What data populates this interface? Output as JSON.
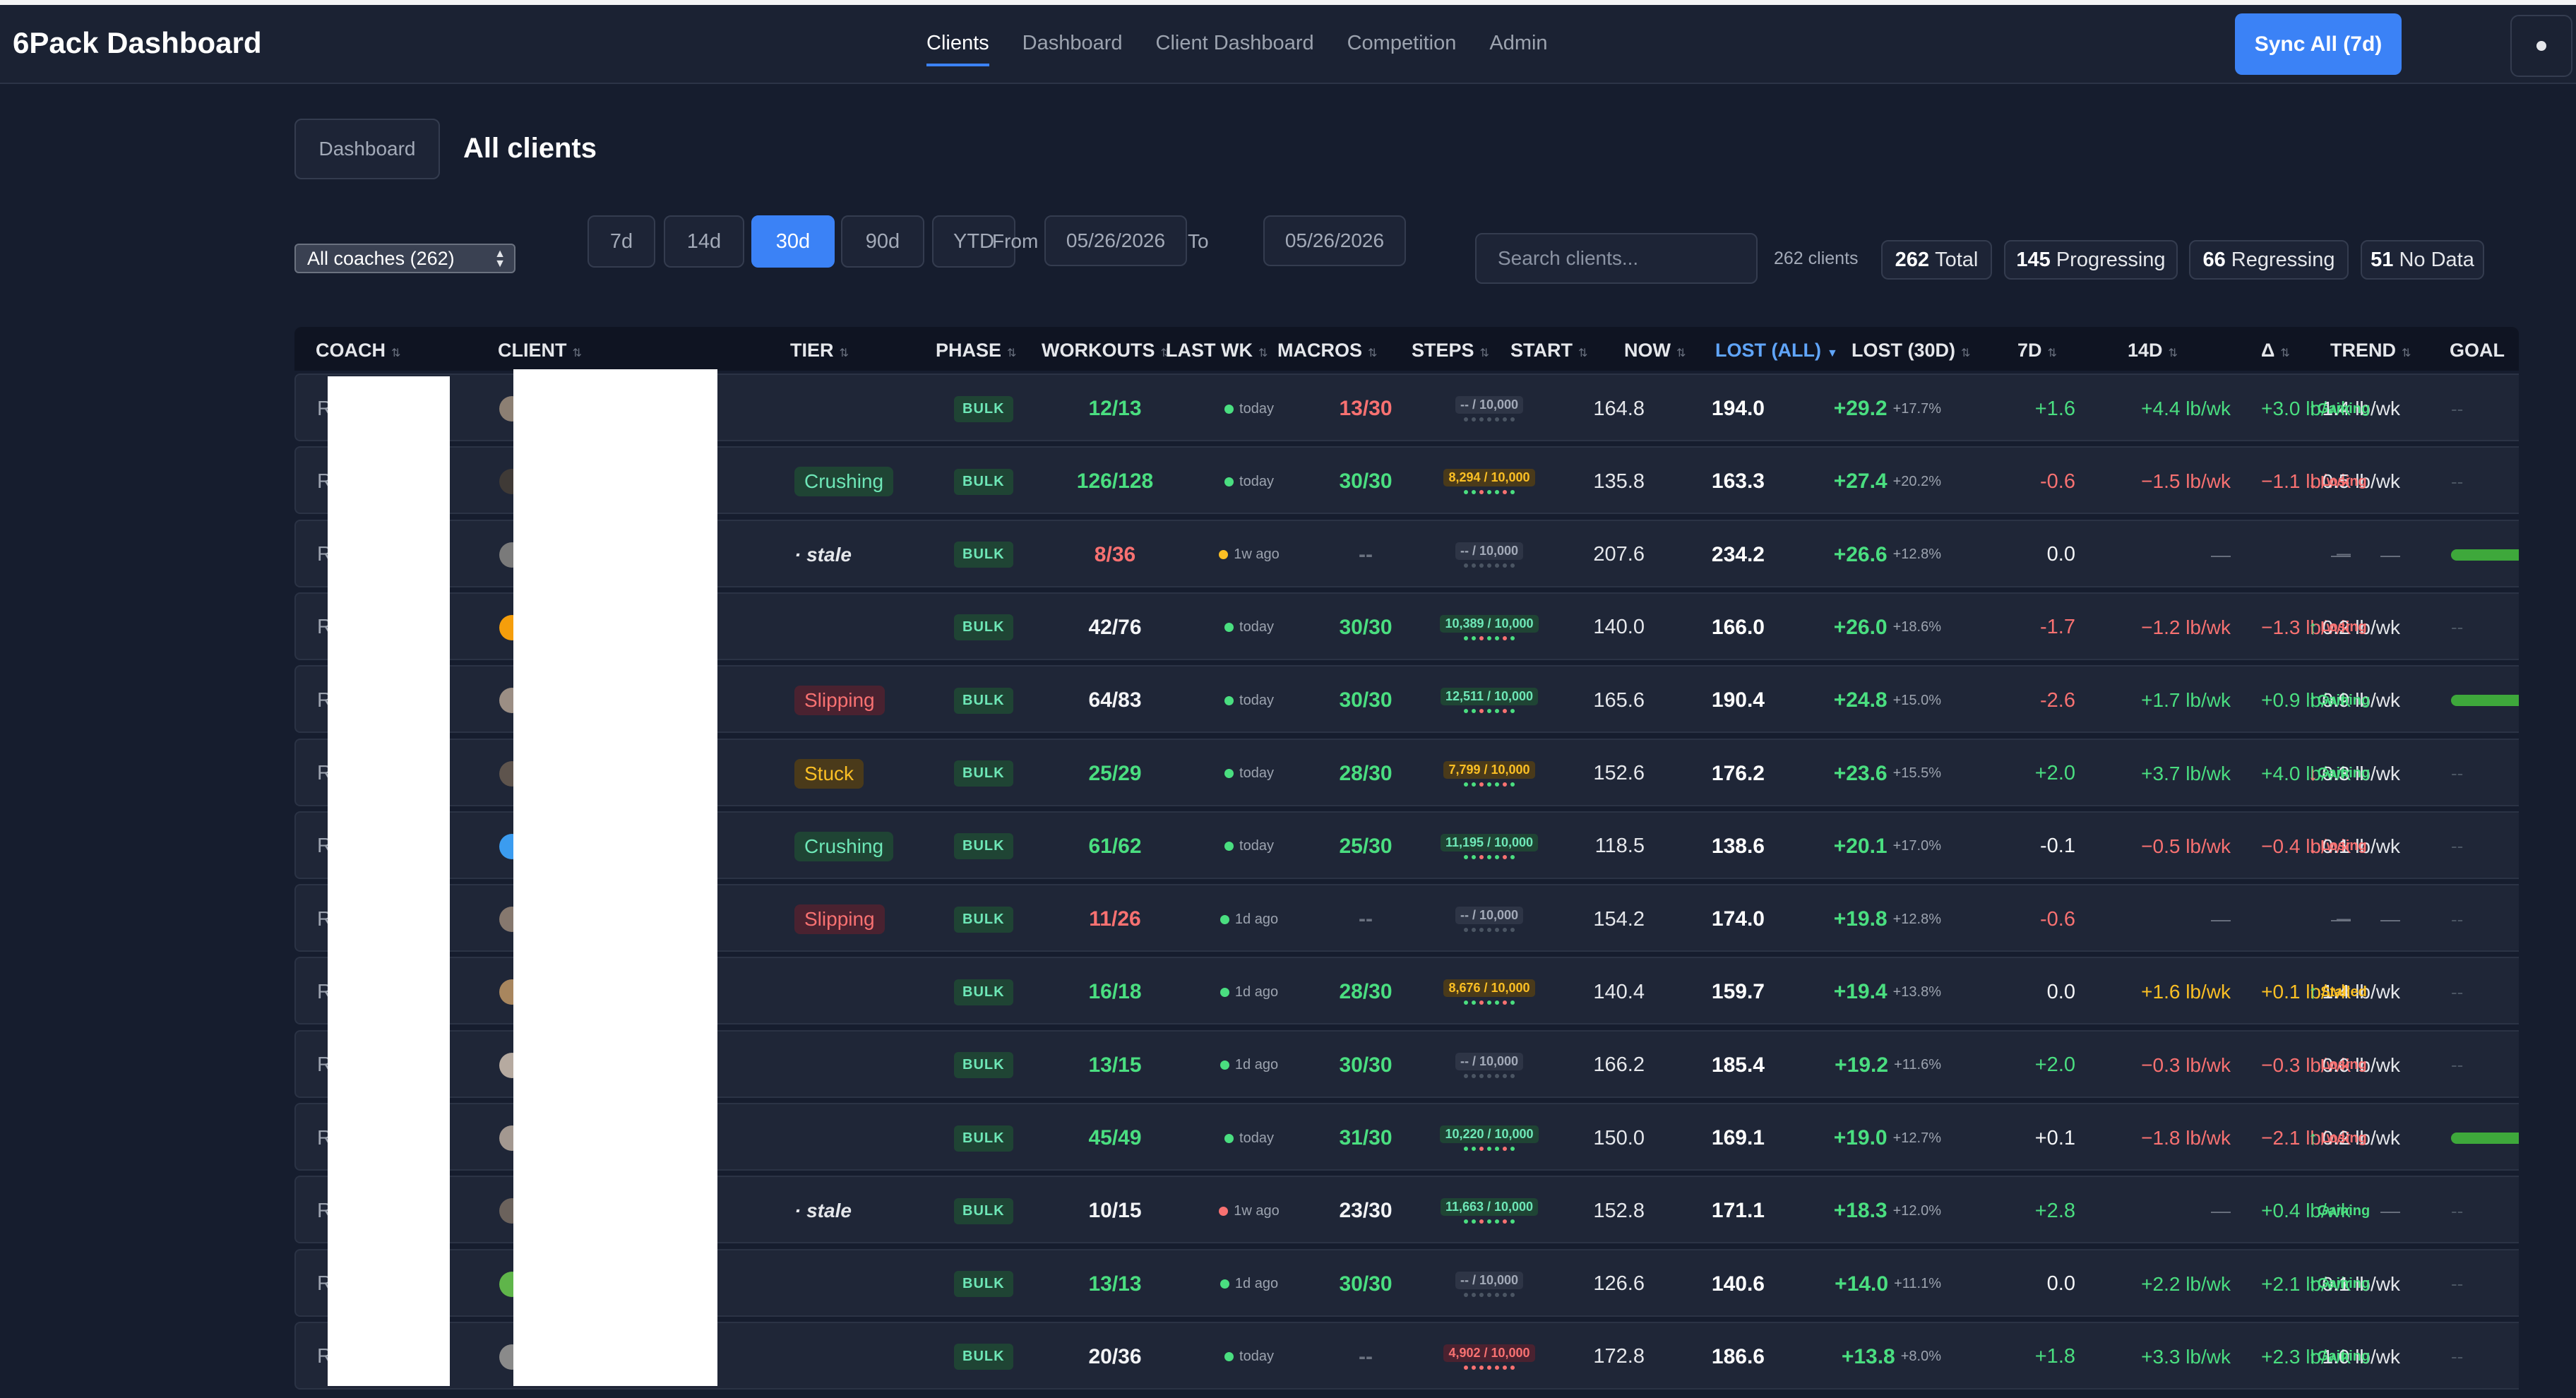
{
  "app": {
    "title": "6Pack Dashboard"
  },
  "nav": [
    {
      "label": "Clients",
      "active": true
    },
    {
      "label": "Dashboard",
      "active": false
    },
    {
      "label": "Client Dashboard",
      "active": false
    },
    {
      "label": "Competition",
      "active": false
    },
    {
      "label": "Admin",
      "active": false
    }
  ],
  "sync_label": "Sync All (7d)",
  "breadcrumb": {
    "back_label": "Dashboard",
    "title": "All clients"
  },
  "filters": {
    "coach_select": "All coaches (262)",
    "ranges": [
      {
        "label": "7d",
        "active": false
      },
      {
        "label": "14d",
        "active": false
      },
      {
        "label": "30d",
        "active": true
      },
      {
        "label": "90d",
        "active": false
      },
      {
        "label": "YTD",
        "active": false
      }
    ],
    "from_label": "From",
    "from_value": "05/26/2026",
    "to_label": "To",
    "to_value": "05/26/2026",
    "search_placeholder": "Search clients...",
    "count_text": "262 clients",
    "stats": [
      {
        "num": "262",
        "label": "Total"
      },
      {
        "num": "145",
        "label": "Progressing"
      },
      {
        "num": "66",
        "label": "Regressing"
      },
      {
        "num": "51",
        "label": "No Data"
      }
    ]
  },
  "columns": [
    "COACH",
    "CLIENT",
    "TIER",
    "PHASE",
    "WORKOUTS",
    "LAST WK",
    "MACROS",
    "STEPS",
    "START",
    "NOW",
    "LOST (ALL)",
    "LOST (30D)",
    "7D",
    "14D",
    "Δ",
    "TREND",
    "GOAL"
  ],
  "colors": {
    "accent": "#3b82f6",
    "positive": "#4ade80",
    "negative": "#f87171",
    "warning": "#fbbf24"
  },
  "rows": [
    {
      "coach": "R",
      "tier": "",
      "phase": "BULK",
      "workouts": "12/13",
      "workouts_color": "green",
      "lastwk": "today",
      "lastwk_dot": "green",
      "macros": "13/30",
      "macros_color": "red",
      "steps": "-- / 10,000",
      "steps_color": "gray",
      "start": "164.8",
      "now": "194.0",
      "lost_all": "+29.2",
      "lost_pct": "+17.7%",
      "lost30": "+1.6",
      "lost30_color": "green",
      "d7": "+4.4 lb/wk",
      "d7_color": "green",
      "d14": "+3.0 lb/wk",
      "d14_color": "green",
      "delta": "1.4 lb/wk",
      "delta_dir": "up",
      "trend": "Gaining",
      "trend_color": "green",
      "goal": "--",
      "goal_bar": false
    },
    {
      "coach": "R",
      "tier": "Crushing",
      "phase": "BULK",
      "workouts": "126/128",
      "workouts_color": "green",
      "lastwk": "today",
      "lastwk_dot": "green",
      "macros": "30/30",
      "macros_color": "green",
      "steps": "8,294 / 10,000",
      "steps_color": "yellow",
      "start": "135.8",
      "now": "163.3",
      "lost_all": "+27.4",
      "lost_pct": "+20.2%",
      "lost30": "-0.6",
      "lost30_color": "red",
      "d7": "−1.5 lb/wk",
      "d7_color": "red",
      "d14": "−1.1 lb/wk",
      "d14_color": "red",
      "delta": "0.5 lb/wk",
      "delta_dir": "down",
      "trend": "Losing",
      "trend_color": "red",
      "goal": "--",
      "goal_bar": false
    },
    {
      "coach": "R",
      "tier": "· stale",
      "phase": "BULK",
      "workouts": "8/36",
      "workouts_color": "red",
      "lastwk": "1w ago",
      "lastwk_dot": "yellow",
      "macros": "--",
      "macros_color": "muted",
      "steps": "-- / 10,000",
      "steps_color": "gray",
      "start": "207.6",
      "now": "234.2",
      "lost_all": "+26.6",
      "lost_pct": "+12.8%",
      "lost30": "0.0",
      "lost30_color": "white",
      "d7": "—",
      "d7_color": "muted",
      "d14": "—",
      "d14_color": "muted",
      "delta": "—",
      "delta_dir": "none",
      "trend": "—",
      "trend_color": "muted",
      "goal": "",
      "goal_bar": true
    },
    {
      "coach": "R",
      "tier": "",
      "phase": "BULK",
      "workouts": "42/76",
      "workouts_color": "white",
      "lastwk": "today",
      "lastwk_dot": "green",
      "macros": "30/30",
      "macros_color": "green",
      "steps": "10,389 / 10,000",
      "steps_color": "green",
      "start": "140.0",
      "now": "166.0",
      "lost_all": "+26.0",
      "lost_pct": "+18.6%",
      "lost30": "-1.7",
      "lost30_color": "red",
      "d7": "−1.2 lb/wk",
      "d7_color": "red",
      "d14": "−1.3 lb/wk",
      "d14_color": "red",
      "delta": "0.2 lb/wk",
      "delta_dir": "up",
      "trend": "Losing",
      "trend_color": "red",
      "goal": "--",
      "goal_bar": false
    },
    {
      "coach": "R",
      "tier": "Slipping",
      "phase": "BULK",
      "workouts": "64/83",
      "workouts_color": "white",
      "lastwk": "today",
      "lastwk_dot": "green",
      "macros": "30/30",
      "macros_color": "green",
      "steps": "12,511 / 10,000",
      "steps_color": "green",
      "start": "165.6",
      "now": "190.4",
      "lost_all": "+24.8",
      "lost_pct": "+15.0%",
      "lost30": "-2.6",
      "lost30_color": "red",
      "d7": "+1.7 lb/wk",
      "d7_color": "green",
      "d14": "+0.9 lb/wk",
      "d14_color": "green",
      "delta": "0.9 lb/wk",
      "delta_dir": "up",
      "trend": "Gaining",
      "trend_color": "green",
      "goal": "",
      "goal_bar": true
    },
    {
      "coach": "R",
      "tier": "Stuck",
      "phase": "BULK",
      "workouts": "25/29",
      "workouts_color": "green",
      "lastwk": "today",
      "lastwk_dot": "green",
      "macros": "28/30",
      "macros_color": "green",
      "steps": "7,799 / 10,000",
      "steps_color": "yellow",
      "start": "152.6",
      "now": "176.2",
      "lost_all": "+23.6",
      "lost_pct": "+15.5%",
      "lost30": "+2.0",
      "lost30_color": "green",
      "d7": "+3.7 lb/wk",
      "d7_color": "green",
      "d14": "+4.0 lb/wk",
      "d14_color": "green",
      "delta": "0.3 lb/wk",
      "delta_dir": "down",
      "trend": "Gaining",
      "trend_color": "green",
      "goal": "--",
      "goal_bar": false
    },
    {
      "coach": "R",
      "tier": "Crushing",
      "phase": "BULK",
      "workouts": "61/62",
      "workouts_color": "green",
      "lastwk": "today",
      "lastwk_dot": "green",
      "macros": "25/30",
      "macros_color": "green",
      "steps": "11,195 / 10,000",
      "steps_color": "green",
      "start": "118.5",
      "now": "138.6",
      "lost_all": "+20.1",
      "lost_pct": "+17.0%",
      "lost30": "-0.1",
      "lost30_color": "white",
      "d7": "−0.5 lb/wk",
      "d7_color": "red",
      "d14": "−0.4 lb/wk",
      "d14_color": "red",
      "delta": "0.1 lb/wk",
      "delta_dir": "down",
      "trend": "Losing",
      "trend_color": "red",
      "goal": "--",
      "goal_bar": false
    },
    {
      "coach": "R",
      "tier": "Slipping",
      "phase": "BULK",
      "workouts": "11/26",
      "workouts_color": "red",
      "lastwk": "1d ago",
      "lastwk_dot": "green",
      "macros": "--",
      "macros_color": "muted",
      "steps": "-- / 10,000",
      "steps_color": "gray",
      "start": "154.2",
      "now": "174.0",
      "lost_all": "+19.8",
      "lost_pct": "+12.8%",
      "lost30": "-0.6",
      "lost30_color": "red",
      "d7": "—",
      "d7_color": "muted",
      "d14": "—",
      "d14_color": "muted",
      "delta": "—",
      "delta_dir": "none",
      "trend": "—",
      "trend_color": "muted",
      "goal": "--",
      "goal_bar": false
    },
    {
      "coach": "R",
      "tier": "",
      "phase": "BULK",
      "workouts": "16/18",
      "workouts_color": "green",
      "lastwk": "1d ago",
      "lastwk_dot": "green",
      "macros": "28/30",
      "macros_color": "green",
      "steps": "8,676 / 10,000",
      "steps_color": "yellow",
      "start": "140.4",
      "now": "159.7",
      "lost_all": "+19.4",
      "lost_pct": "+13.8%",
      "lost30": "0.0",
      "lost30_color": "white",
      "d7": "+1.6 lb/wk",
      "d7_color": "yellow",
      "d14": "+0.1 lb/wk",
      "d14_color": "yellow",
      "delta": "1.4 lb/wk",
      "delta_dir": "up",
      "trend": "Stalled",
      "trend_color": "yellow",
      "goal": "--",
      "goal_bar": false
    },
    {
      "coach": "R",
      "tier": "",
      "phase": "BULK",
      "workouts": "13/15",
      "workouts_color": "green",
      "lastwk": "1d ago",
      "lastwk_dot": "green",
      "macros": "30/30",
      "macros_color": "green",
      "steps": "-- / 10,000",
      "steps_color": "gray",
      "start": "166.2",
      "now": "185.4",
      "lost_all": "+19.2",
      "lost_pct": "+11.6%",
      "lost30": "+2.0",
      "lost30_color": "green",
      "d7": "−0.3 lb/wk",
      "d7_color": "red",
      "d14": "−0.3 lb/wk",
      "d14_color": "red",
      "delta": "0.0 lb/wk",
      "delta_dir": "none",
      "trend": "Losing",
      "trend_color": "red",
      "goal": "--",
      "goal_bar": false
    },
    {
      "coach": "R",
      "tier": "",
      "phase": "BULK",
      "workouts": "45/49",
      "workouts_color": "green",
      "lastwk": "today",
      "lastwk_dot": "green",
      "macros": "31/30",
      "macros_color": "green",
      "steps": "10,220 / 10,000",
      "steps_color": "green",
      "start": "150.0",
      "now": "169.1",
      "lost_all": "+19.0",
      "lost_pct": "+12.7%",
      "lost30": "+0.1",
      "lost30_color": "white",
      "d7": "−1.8 lb/wk",
      "d7_color": "red",
      "d14": "−2.1 lb/wk",
      "d14_color": "red",
      "delta": "0.2 lb/wk",
      "delta_dir": "up",
      "trend": "Losing",
      "trend_color": "red",
      "goal": "",
      "goal_bar": true
    },
    {
      "coach": "R",
      "tier": "· stale",
      "phase": "BULK",
      "workouts": "10/15",
      "workouts_color": "white",
      "lastwk": "1w ago",
      "lastwk_dot": "red",
      "macros": "23/30",
      "macros_color": "white",
      "steps": "11,663 / 10,000",
      "steps_color": "green",
      "start": "152.8",
      "now": "171.1",
      "lost_all": "+18.3",
      "lost_pct": "+12.0%",
      "lost30": "+2.8",
      "lost30_color": "green",
      "d7": "—",
      "d7_color": "muted",
      "d14": "+0.4 lb/wk",
      "d14_color": "green",
      "delta": "—",
      "delta_dir": "none",
      "trend": "Gaining",
      "trend_color": "green",
      "goal": "--",
      "goal_bar": false
    },
    {
      "coach": "R",
      "tier": "",
      "phase": "BULK",
      "workouts": "13/13",
      "workouts_color": "green",
      "lastwk": "1d ago",
      "lastwk_dot": "green",
      "macros": "30/30",
      "macros_color": "green",
      "steps": "-- / 10,000",
      "steps_color": "gray",
      "start": "126.6",
      "now": "140.6",
      "lost_all": "+14.0",
      "lost_pct": "+11.1%",
      "lost30": "0.0",
      "lost30_color": "white",
      "d7": "+2.2 lb/wk",
      "d7_color": "green",
      "d14": "+2.1 lb/wk",
      "d14_color": "green",
      "delta": "0.1 lb/wk",
      "delta_dir": "up",
      "trend": "Gaining",
      "trend_color": "green",
      "goal": "--",
      "goal_bar": false
    },
    {
      "coach": "R",
      "tier": "",
      "phase": "BULK",
      "workouts": "20/36",
      "workouts_color": "white",
      "lastwk": "today",
      "lastwk_dot": "green",
      "macros": "--",
      "macros_color": "muted",
      "steps": "4,902 / 10,000",
      "steps_color": "red",
      "start": "172.8",
      "now": "186.6",
      "lost_all": "+13.8",
      "lost_pct": "+8.0%",
      "lost30": "+1.8",
      "lost30_color": "green",
      "d7": "+3.3 lb/wk",
      "d7_color": "green",
      "d14": "+2.3 lb/wk",
      "d14_color": "green",
      "delta": "1.0 lb/wk",
      "delta_dir": "up",
      "trend": "Gaining",
      "trend_color": "green",
      "goal": "--",
      "goal_bar": false
    }
  ]
}
